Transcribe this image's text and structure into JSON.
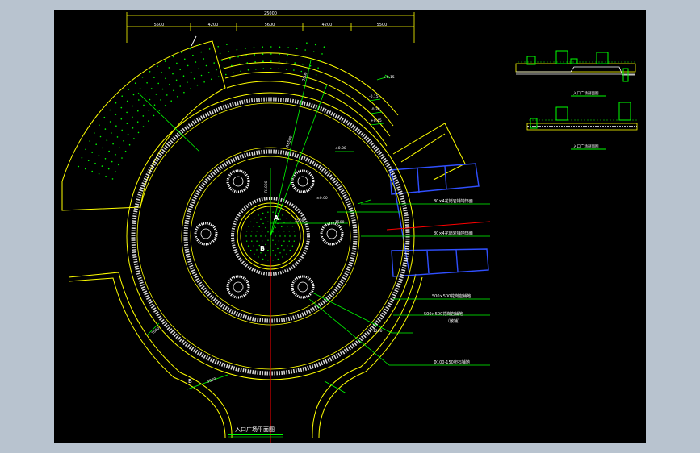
{
  "colors": {
    "background_outer": "#b8c3cf",
    "canvas": "#000000",
    "yellow": "#ffff00",
    "white": "#ffffff",
    "green": "#00ff00",
    "red": "#ff0000",
    "blue": "#0000ff"
  },
  "dimensions": {
    "total": "25000",
    "segments": [
      "5500",
      "4200",
      "5600",
      "4200",
      "5500"
    ]
  },
  "labels": {
    "title": "入口广场平面图",
    "section_a": "A",
    "section_b": "B",
    "section_b_left": "B",
    "detail_title_1": "入口广场剖面图",
    "detail_title_2": "入口广场剖面图",
    "radius_r1000": "R1000",
    "radius_r6500": "R6500",
    "dim_3500": "3500",
    "dim_1500": "1500",
    "dim_1200": "1200",
    "dim_1000": "1000",
    "dim_2500": "2500",
    "dim_5000": "5000",
    "level_a": "±0.00",
    "level_b": "±0.00",
    "level_c": "-0.15",
    "level_d": "-0.30",
    "level_e": "+0.45",
    "level_f": "+0.15",
    "callout_1": "80×4花岗岩铺地饰面",
    "callout_2": "80×4花岗岩铺地饰面",
    "callout_3": "500×500花岗岩铺地",
    "callout_4": "500×500花岗岩铺地",
    "callout_4b": "（散铺）",
    "callout_5": "Φ100-150卵石铺地"
  }
}
